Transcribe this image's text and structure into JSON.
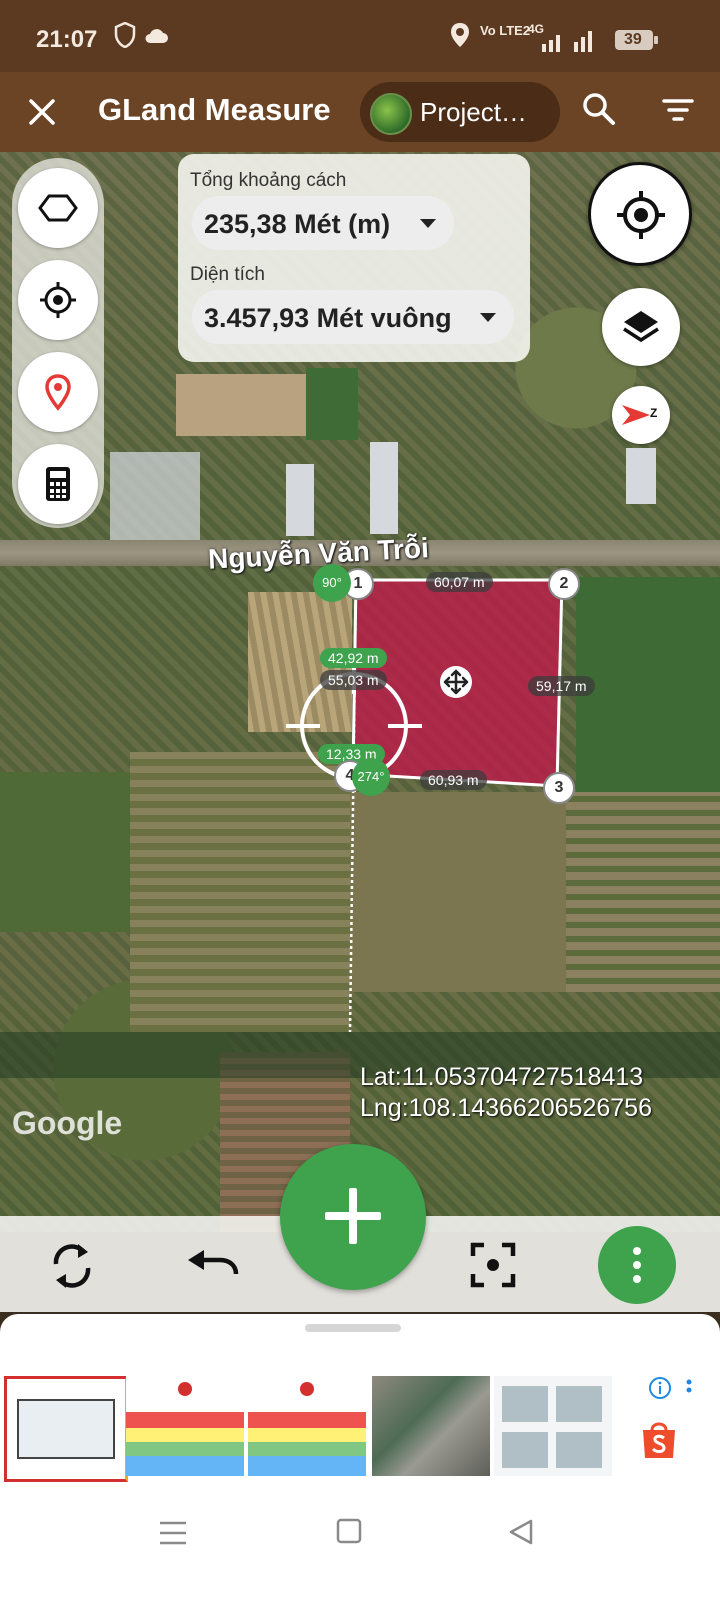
{
  "status": {
    "time": "21:07",
    "network": "Vo LTE2",
    "signal": "4G",
    "battery": "39"
  },
  "header": {
    "title": "GLand Measure",
    "project": "Project…"
  },
  "summary": {
    "distance_label": "Tổng khoảng cách",
    "distance_value": "235,38 Mét (m)",
    "area_label": "Diện tích",
    "area_value": "3.457,93 Mét vuông"
  },
  "map": {
    "road_name": "Nguyễn Văn Trỗi",
    "plot_color": "#c2184a",
    "segments": {
      "s12": "60,07 m",
      "s23": "59,17 m",
      "s34": "60,93 m",
      "s41a": "42,92 m",
      "s41b": "55,03 m",
      "s41c": "12,33 m"
    },
    "vertices": {
      "v1": "1",
      "v2": "2",
      "v3": "3",
      "v4": "4"
    },
    "angles": {
      "a1": "90°",
      "a4": "274°"
    },
    "lat": "Lat:11.053704727518413",
    "lng": "Lng:108.14366206526756",
    "attribution": "Google"
  },
  "compass": {
    "letter": "Z"
  },
  "accent_color": "#3fa34d"
}
